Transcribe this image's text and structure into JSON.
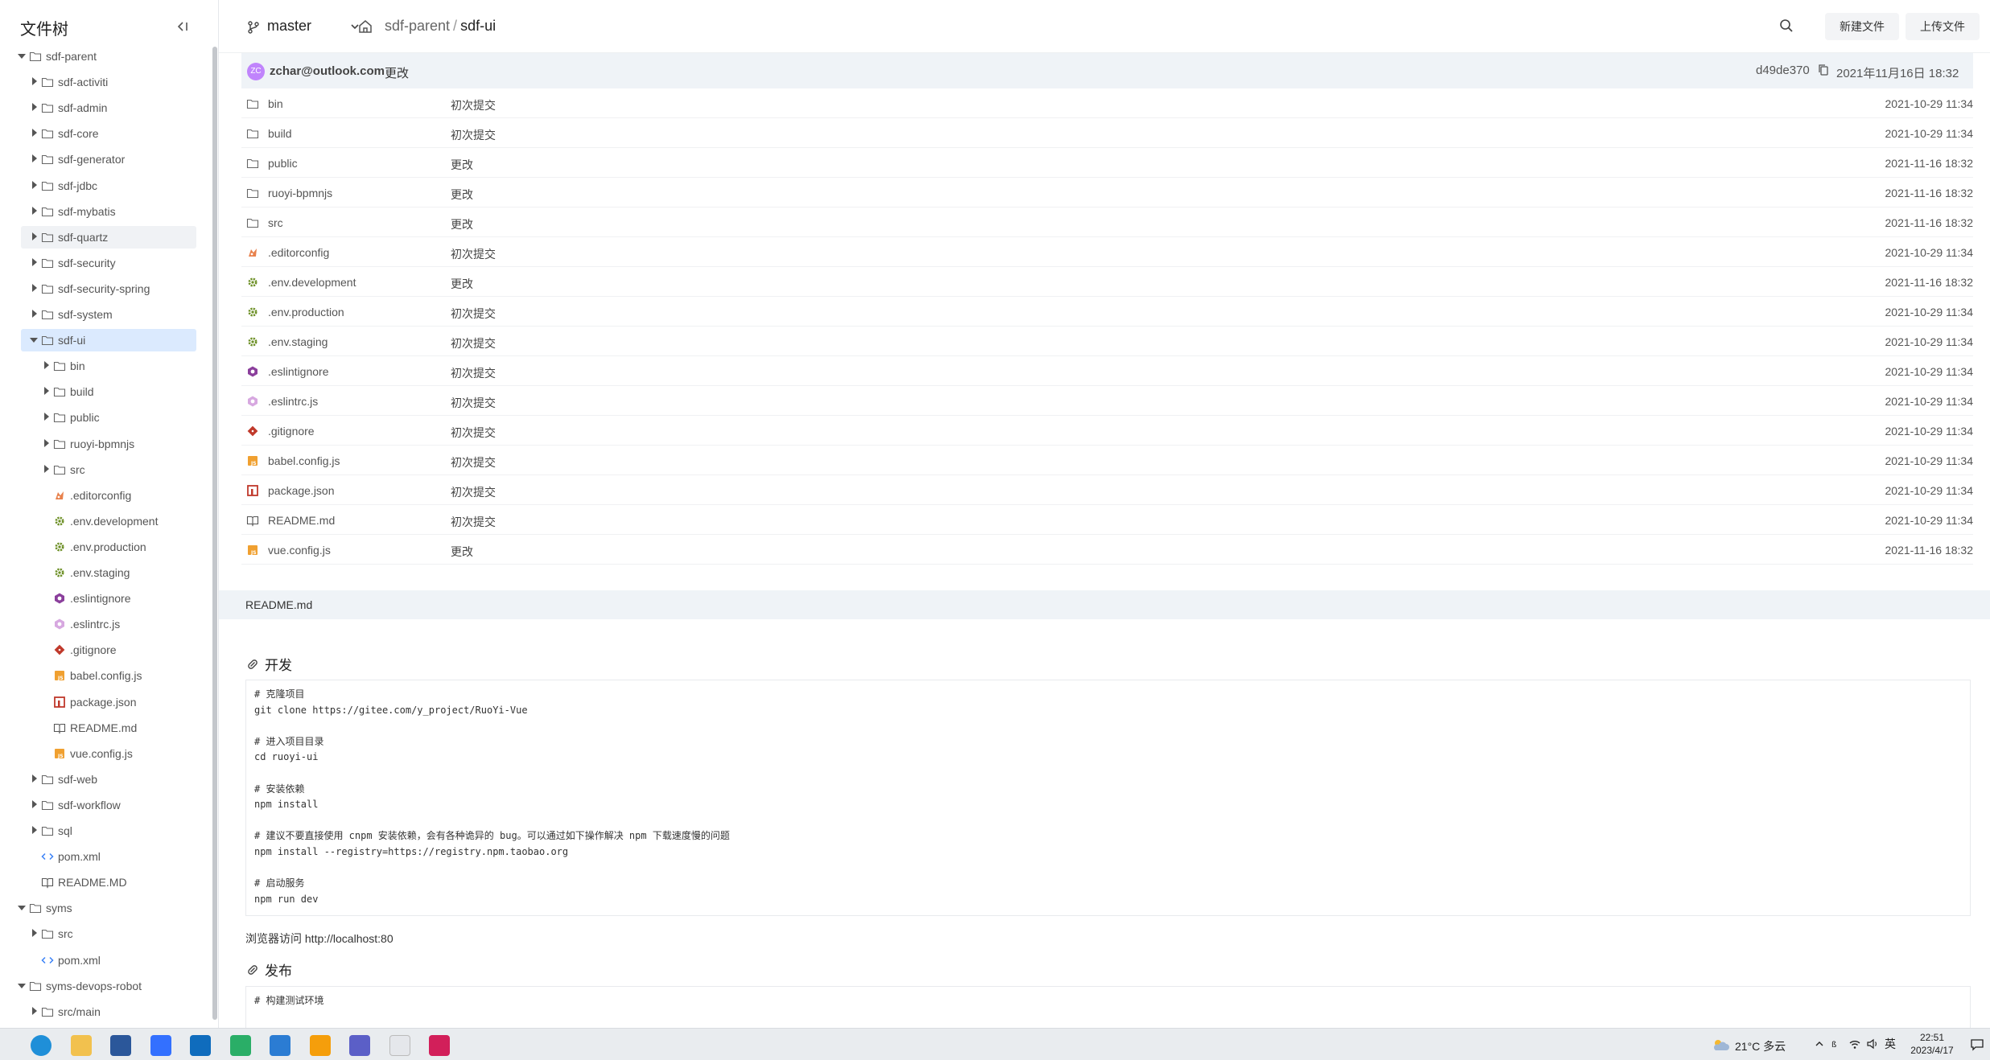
{
  "sidebar": {
    "title": "文件树",
    "collapse_icon": "collapse-left-icon",
    "tree": [
      {
        "label": "sdf-parent",
        "depth": 0,
        "kind": "folder",
        "state": "expanded"
      },
      {
        "label": "sdf-activiti",
        "depth": 1,
        "kind": "folder",
        "state": "collapsed"
      },
      {
        "label": "sdf-admin",
        "depth": 1,
        "kind": "folder",
        "state": "collapsed"
      },
      {
        "label": "sdf-core",
        "depth": 1,
        "kind": "folder",
        "state": "collapsed"
      },
      {
        "label": "sdf-generator",
        "depth": 1,
        "kind": "folder",
        "state": "collapsed"
      },
      {
        "label": "sdf-jdbc",
        "depth": 1,
        "kind": "folder",
        "state": "collapsed"
      },
      {
        "label": "sdf-mybatis",
        "depth": 1,
        "kind": "folder",
        "state": "collapsed"
      },
      {
        "label": "sdf-quartz",
        "depth": 1,
        "kind": "folder",
        "state": "collapsed",
        "hover": true
      },
      {
        "label": "sdf-security",
        "depth": 1,
        "kind": "folder",
        "state": "collapsed"
      },
      {
        "label": "sdf-security-spring",
        "depth": 1,
        "kind": "folder",
        "state": "collapsed"
      },
      {
        "label": "sdf-system",
        "depth": 1,
        "kind": "folder",
        "state": "collapsed"
      },
      {
        "label": "sdf-ui",
        "depth": 1,
        "kind": "folder",
        "state": "expanded",
        "selected": true
      },
      {
        "label": "bin",
        "depth": 2,
        "kind": "folder",
        "state": "collapsed"
      },
      {
        "label": "build",
        "depth": 2,
        "kind": "folder",
        "state": "collapsed"
      },
      {
        "label": "public",
        "depth": 2,
        "kind": "folder",
        "state": "collapsed"
      },
      {
        "label": "ruoyi-bpmnjs",
        "depth": 2,
        "kind": "folder",
        "state": "collapsed"
      },
      {
        "label": "src",
        "depth": 2,
        "kind": "folder",
        "state": "collapsed"
      },
      {
        "label": ".editorconfig",
        "depth": 2,
        "kind": "editorconfig"
      },
      {
        "label": ".env.development",
        "depth": 2,
        "kind": "gear"
      },
      {
        "label": ".env.production",
        "depth": 2,
        "kind": "gear"
      },
      {
        "label": ".env.staging",
        "depth": 2,
        "kind": "gear"
      },
      {
        "label": ".eslintignore",
        "depth": 2,
        "kind": "eslint"
      },
      {
        "label": ".eslintrc.js",
        "depth": 2,
        "kind": "eslint-light"
      },
      {
        "label": ".gitignore",
        "depth": 2,
        "kind": "git"
      },
      {
        "label": "babel.config.js",
        "depth": 2,
        "kind": "js"
      },
      {
        "label": "package.json",
        "depth": 2,
        "kind": "npm"
      },
      {
        "label": "README.md",
        "depth": 2,
        "kind": "book"
      },
      {
        "label": "vue.config.js",
        "depth": 2,
        "kind": "js"
      },
      {
        "label": "sdf-web",
        "depth": 1,
        "kind": "folder",
        "state": "collapsed"
      },
      {
        "label": "sdf-workflow",
        "depth": 1,
        "kind": "folder",
        "state": "collapsed"
      },
      {
        "label": "sql",
        "depth": 1,
        "kind": "folder",
        "state": "collapsed"
      },
      {
        "label": "pom.xml",
        "depth": 1,
        "kind": "xml"
      },
      {
        "label": "README.MD",
        "depth": 1,
        "kind": "book"
      },
      {
        "label": "syms",
        "depth": 0,
        "kind": "folder",
        "state": "expanded"
      },
      {
        "label": "src",
        "depth": 1,
        "kind": "folder",
        "state": "collapsed"
      },
      {
        "label": "pom.xml",
        "depth": 1,
        "kind": "xml"
      },
      {
        "label": "syms-devops-robot",
        "depth": 0,
        "kind": "folder",
        "state": "expanded"
      },
      {
        "label": "src/main",
        "depth": 1,
        "kind": "folder",
        "state": "collapsed"
      }
    ]
  },
  "topbar": {
    "branch": "master",
    "breadcrumb_parent": "sdf-parent",
    "breadcrumb_sep": "/",
    "breadcrumb_current": "sdf-ui",
    "new_file_label": "新建文件",
    "upload_label": "上传文件"
  },
  "commit": {
    "avatar_initials": "ZC",
    "author": "zchar@outlook.com",
    "message": "更改",
    "hash": "d49de370",
    "time": "2021年11月16日 18:32"
  },
  "files": [
    {
      "name": "bin",
      "kind": "folder",
      "message": "初次提交",
      "time": "2021-10-29 11:34"
    },
    {
      "name": "build",
      "kind": "folder",
      "message": "初次提交",
      "time": "2021-10-29 11:34"
    },
    {
      "name": "public",
      "kind": "folder",
      "message": "更改",
      "time": "2021-11-16 18:32"
    },
    {
      "name": "ruoyi-bpmnjs",
      "kind": "folder",
      "message": "更改",
      "time": "2021-11-16 18:32"
    },
    {
      "name": "src",
      "kind": "folder",
      "message": "更改",
      "time": "2021-11-16 18:32"
    },
    {
      "name": ".editorconfig",
      "kind": "editorconfig",
      "message": "初次提交",
      "time": "2021-10-29 11:34"
    },
    {
      "name": ".env.development",
      "kind": "gear",
      "message": "更改",
      "time": "2021-11-16 18:32"
    },
    {
      "name": ".env.production",
      "kind": "gear",
      "message": "初次提交",
      "time": "2021-10-29 11:34"
    },
    {
      "name": ".env.staging",
      "kind": "gear",
      "message": "初次提交",
      "time": "2021-10-29 11:34"
    },
    {
      "name": ".eslintignore",
      "kind": "eslint",
      "message": "初次提交",
      "time": "2021-10-29 11:34"
    },
    {
      "name": ".eslintrc.js",
      "kind": "eslint-light",
      "message": "初次提交",
      "time": "2021-10-29 11:34"
    },
    {
      "name": ".gitignore",
      "kind": "git",
      "message": "初次提交",
      "time": "2021-10-29 11:34"
    },
    {
      "name": "babel.config.js",
      "kind": "js",
      "message": "初次提交",
      "time": "2021-10-29 11:34"
    },
    {
      "name": "package.json",
      "kind": "npm",
      "message": "初次提交",
      "time": "2021-10-29 11:34"
    },
    {
      "name": "README.md",
      "kind": "book",
      "message": "初次提交",
      "time": "2021-10-29 11:34"
    },
    {
      "name": "vue.config.js",
      "kind": "js",
      "message": "更改",
      "time": "2021-11-16 18:32"
    }
  ],
  "readme": {
    "title": "README.md",
    "heading_dev": "开发",
    "code_dev": "# 克隆项目\ngit clone https://gitee.com/y_project/RuoYi-Vue\n\n# 进入项目目录\ncd ruoyi-ui\n\n# 安装依赖\nnpm install\n\n# 建议不要直接使用 cnpm 安装依赖，会有各种诡异的 bug。可以通过如下操作解决 npm 下载速度慢的问题\nnpm install --registry=https://registry.npm.taobao.org\n\n# 启动服务\nnpm run dev",
    "browser_prefix": "浏览器访问 ",
    "browser_url": "http://localhost:80",
    "heading_publish": "发布",
    "code_publish": "# 构建测试环境"
  },
  "taskbar": {
    "weather": "21°C  多云",
    "ime": "英",
    "time": "22:51",
    "date": "2023/4/17",
    "apps": [
      "edge-icon",
      "explorer-icon",
      "mail-icon",
      "feishu-icon",
      "outlook-icon",
      "wechat-icon",
      "todo-icon",
      "app-orange-icon",
      "app-purple-icon",
      "notepad-icon",
      "intellij-icon"
    ]
  },
  "colors": {
    "accent": "#3b82f6",
    "selected_bg": "#dbeafe",
    "header_bg": "#eff3f7",
    "avatar": "#c084fc"
  }
}
